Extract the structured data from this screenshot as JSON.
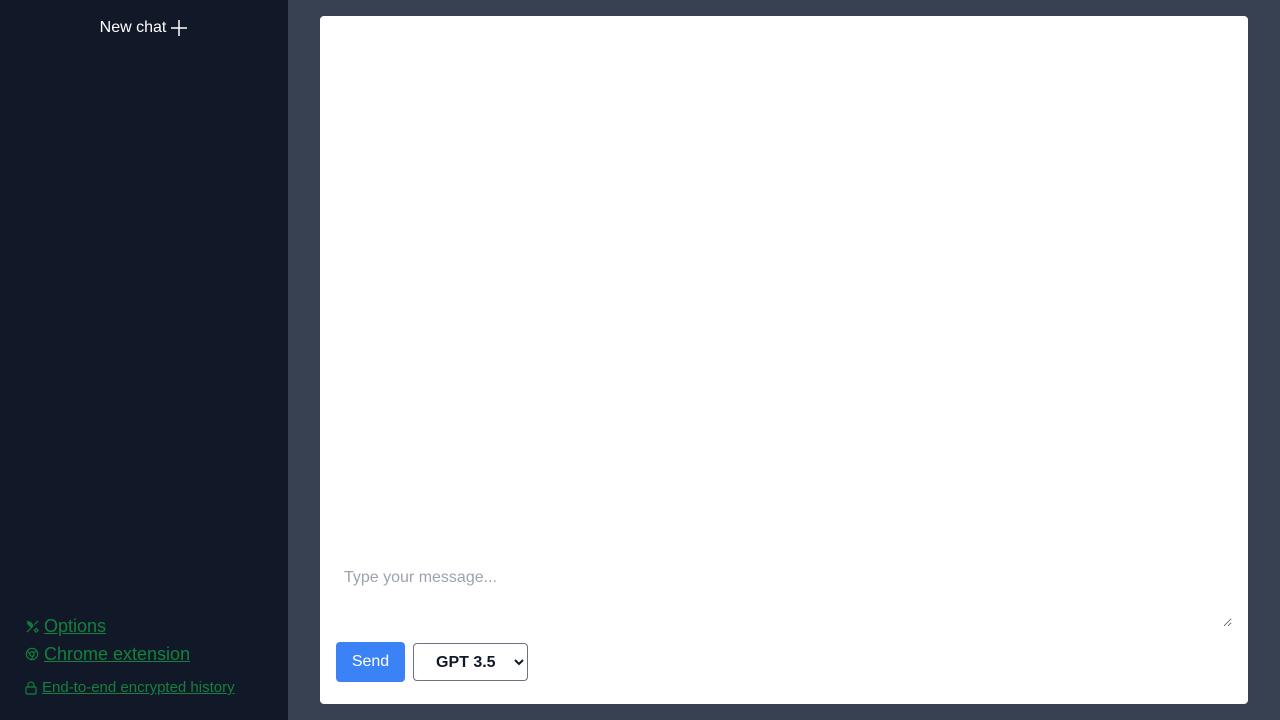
{
  "sidebar": {
    "new_chat_label": "New chat",
    "links": [
      {
        "label": " Options",
        "icon": "tools-icon"
      },
      {
        "label": " Chrome extension",
        "icon": "chrome-icon"
      },
      {
        "label": " End-to-end encrypted history",
        "icon": "lock-icon"
      }
    ]
  },
  "composer": {
    "placeholder": "Type your message...",
    "send_label": "Send",
    "model_selected": "GPT 3.5"
  },
  "colors": {
    "sidebar_bg": "#111827",
    "main_bg": "#374151",
    "link_green": "#15803d",
    "send_blue": "#3b82f6"
  }
}
